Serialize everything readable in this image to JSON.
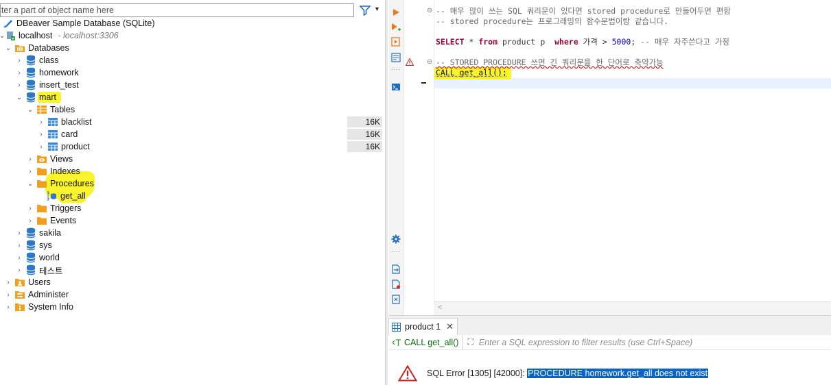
{
  "navigator": {
    "filter_placeholder": "nter a part of object name here",
    "tree": {
      "sample_db": "DBeaver Sample Database (SQLite)",
      "connection": {
        "name": "localhost",
        "hint": "- localhost:3306"
      },
      "databases": "Databases",
      "db_class": "class",
      "db_homework": "homework",
      "db_insert_test": "insert_test",
      "db_mart": "mart",
      "tables": "Tables",
      "table_blacklist": "blacklist",
      "table_card": "card",
      "table_product": "product",
      "table_sizes": [
        "16K",
        "16K",
        "16K"
      ],
      "views": "Views",
      "indexes": "Indexes",
      "procedures": "Procedures",
      "proc_get_all": "get_all",
      "triggers": "Triggers",
      "events": "Events",
      "db_sakila": "sakila",
      "db_sys": "sys",
      "db_world": "world",
      "db_test_kr": "테스트",
      "users": "Users",
      "administer": "Administer",
      "system_info": "System Info"
    }
  },
  "editor": {
    "lines": {
      "l1": "-- 매우 많이 쓰는 SQL 쿼리문이 있다면 stored procedure로 만들어두면 편함",
      "l2": "-- stored procedure는 프로그래밍의 함수문법이랑 같습니다.",
      "l4_kw_select": "SELECT",
      "l4_a": " * ",
      "l4_kw_from": "from",
      "l4_b": " product p  ",
      "l4_kw_where": "where",
      "l4_c": " 가격 > ",
      "l4_num": "5000",
      "l4_d": ";",
      "l4_cmt": " -- 매우 자주쓴다고 가정",
      "l6": "-- STORED PROCEDURE 쓰면 긴 쿼리문을 한 단어로 축약가능",
      "l7": "CALL get_all();"
    }
  },
  "results": {
    "tab_label": "product 1",
    "query_label": "CALL get_all()",
    "filter_placeholder": "Enter a SQL expression to filter results (use Ctrl+Space)",
    "error_prefix": "SQL Error [1305] [42000]: ",
    "error_selected": "PROCEDURE homework.get_all does not exist"
  },
  "colors": {
    "highlight": "#f8f32b",
    "selection": "#0a64c8",
    "keyword": "#a0003a",
    "number": "#0000d8"
  }
}
